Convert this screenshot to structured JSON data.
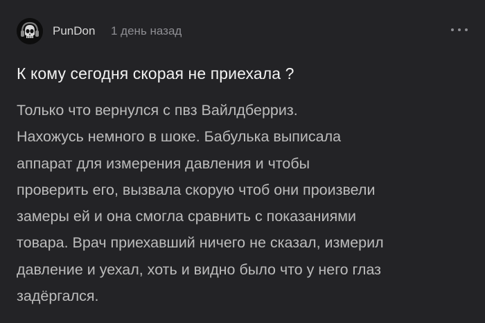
{
  "author": {
    "name": "PunDon",
    "avatar_icon": "skull-avatar-icon"
  },
  "meta": {
    "time": "1 день назад"
  },
  "menu": {
    "icon": "more-dots-icon"
  },
  "post": {
    "title": "К кому сегодня скорая не приехала ?",
    "lines": [
      "Только что вернулся с пвз Вайлдберриз.",
      "Нахожусь немного в шоке. Бабулька выписала",
      "аппарат для измерения давления и чтобы",
      "проверить его, вызвала скорую чтоб они произвели",
      "замеры ей и она смогла сравнить с показаниями",
      "товара. Врач приехавший ничего не сказал, измерил",
      "давление и уехал, хоть и видно было что у него глаз",
      "задёргался."
    ]
  },
  "colors": {
    "background": "#232326",
    "title": "#f2f2f2",
    "body": "#bcbcbc",
    "meta": "#8e8e93"
  }
}
